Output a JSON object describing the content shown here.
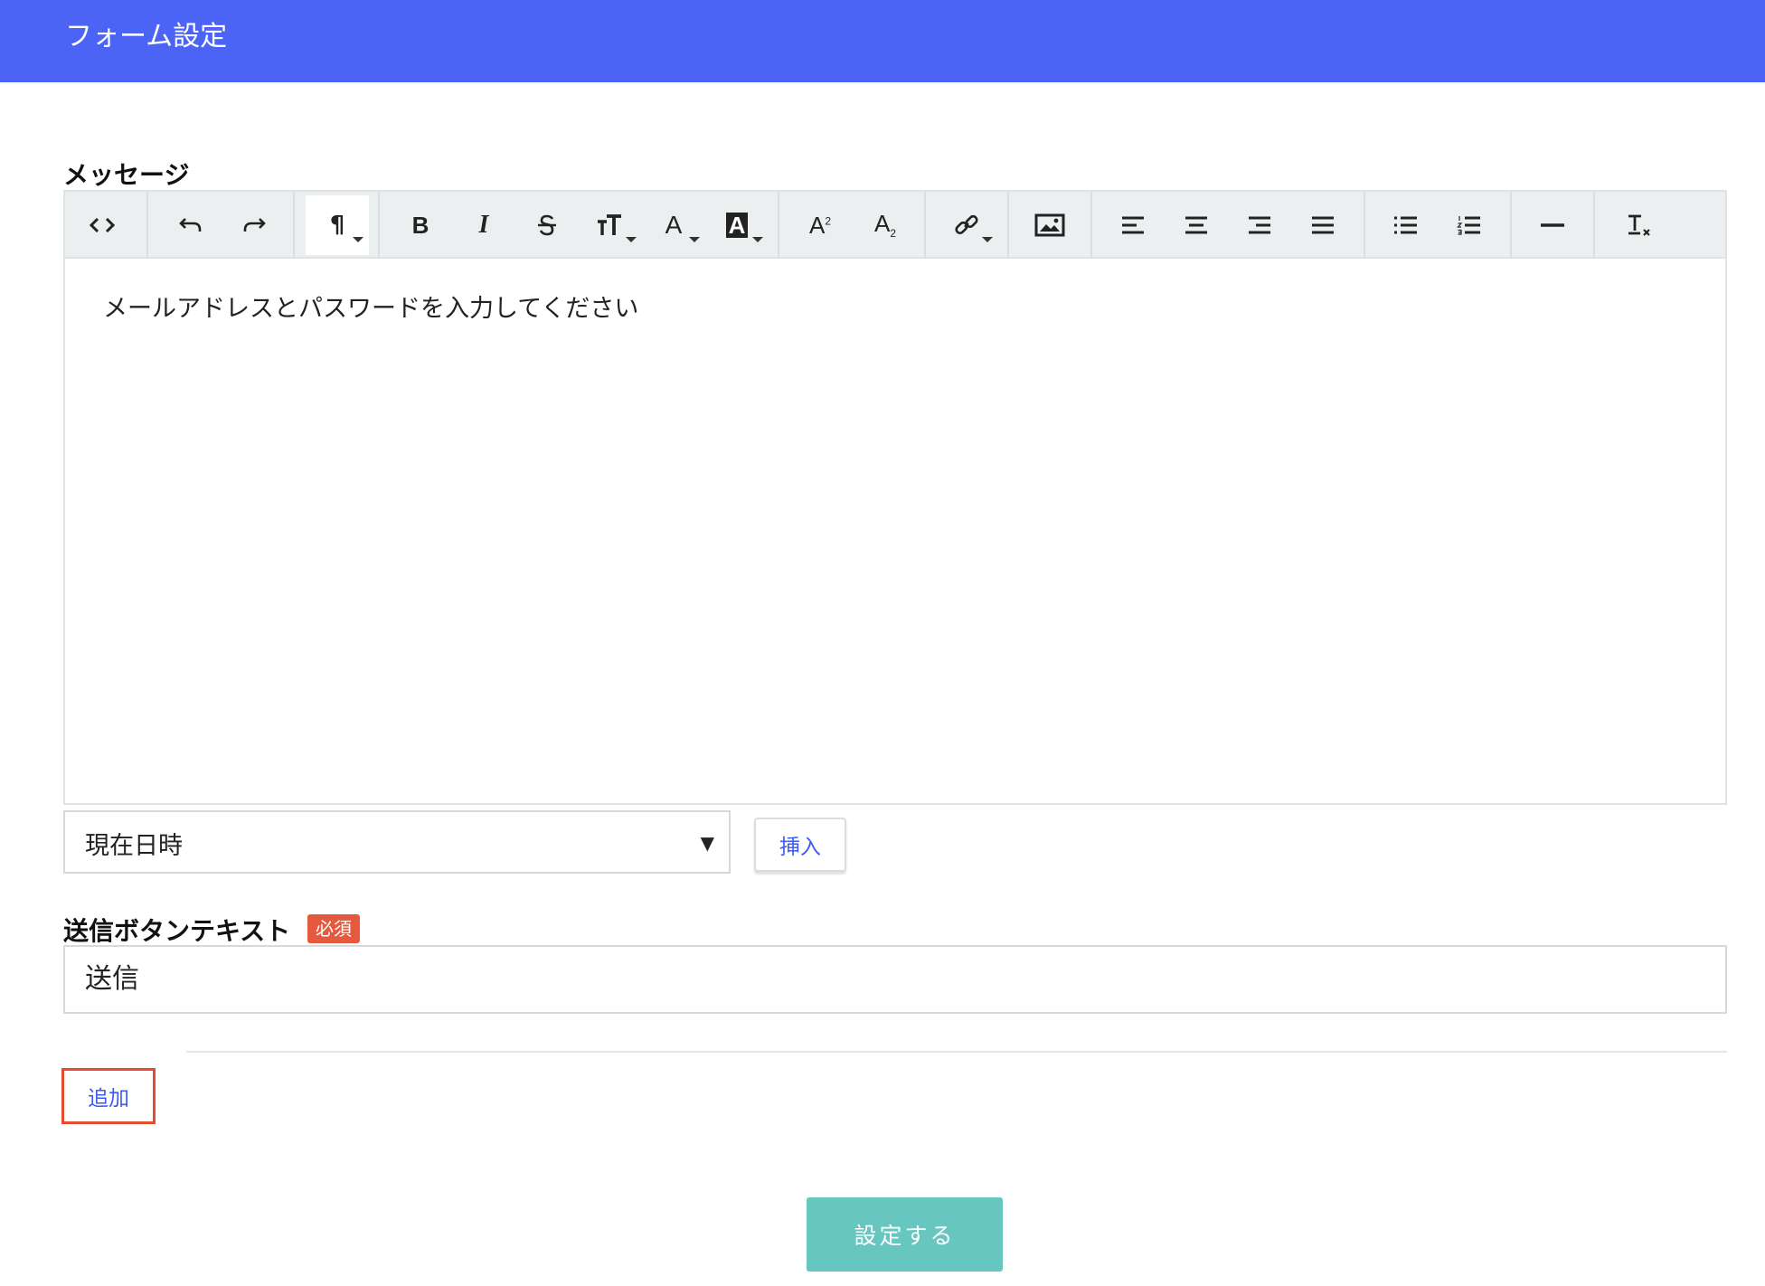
{
  "header": {
    "title": "フォーム設定"
  },
  "message": {
    "label": "メッセージ",
    "content": "メールアドレスとパスワードを入力してください",
    "toolbar": {
      "code": "code-view-icon",
      "undo": "undo-icon",
      "redo": "redo-icon",
      "paragraph": "¶",
      "bold": "B",
      "italic": "I",
      "strike": "strikethrough-icon",
      "font_size": "font-size-icon",
      "font_color": "A",
      "highlight": "A",
      "superscript": "A",
      "subscript": "A",
      "link": "link-icon",
      "image": "image-icon",
      "align_left": "align-left-icon",
      "align_center": "align-center-icon",
      "align_right": "align-right-icon",
      "align_justify": "align-justify-icon",
      "bullet_list": "bullet-list-icon",
      "ordered_list": "ordered-list-icon",
      "horizontal_rule": "horizontal-rule-icon",
      "clear_format": "clear-format-icon"
    }
  },
  "variable_select": {
    "value": "現在日時",
    "arrow": "▼"
  },
  "insert_button": {
    "label": "挿入"
  },
  "submit_text": {
    "label": "送信ボタンテキスト",
    "required": "必須",
    "value": "送信"
  },
  "add_button": {
    "label": "追加"
  },
  "save_button": {
    "label": "設定する"
  }
}
